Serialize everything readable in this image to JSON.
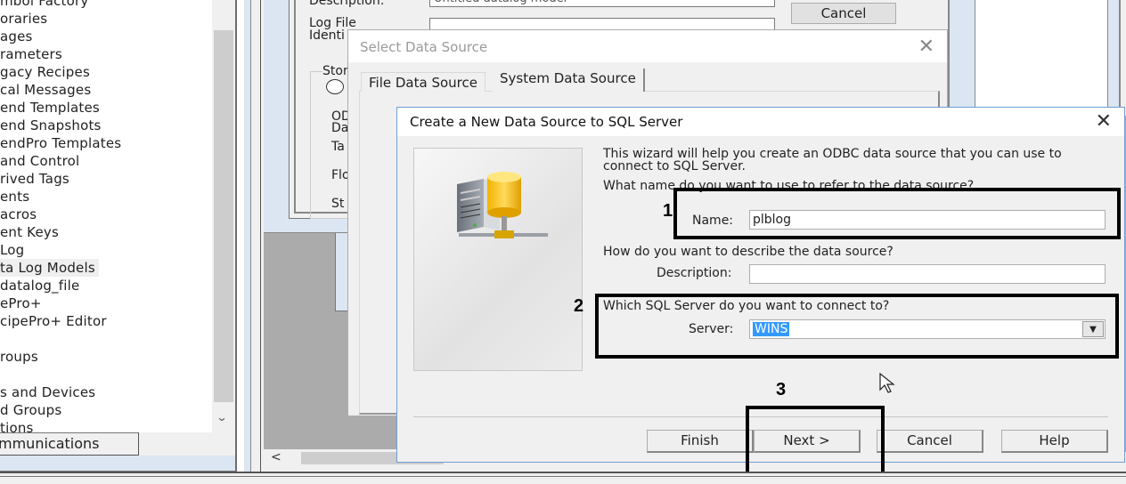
{
  "left_panel": {
    "tree_items": [
      {
        "label": "mbol Factory"
      },
      {
        "label": "oraries"
      },
      {
        "label": "ages"
      },
      {
        "label": "rameters"
      },
      {
        "label": "gacy Recipes"
      },
      {
        "label": "cal Messages"
      },
      {
        "label": "end Templates"
      },
      {
        "label": "end Snapshots"
      },
      {
        "label": "endPro Templates"
      },
      {
        "label": " and Control"
      },
      {
        "label": "rived Tags"
      },
      {
        "label": "ents"
      },
      {
        "label": "acros"
      },
      {
        "label": "ent Keys"
      },
      {
        "label": "Log"
      },
      {
        "label": "ta Log Models",
        "selected": true
      },
      {
        "label": "datalog_file"
      },
      {
        "label": "ePro+"
      },
      {
        "label": "cipePro+ Editor"
      },
      {
        "label": ""
      },
      {
        "label": "roups"
      },
      {
        "label": ""
      },
      {
        "label": "s and Devices"
      },
      {
        "label": "d Groups"
      },
      {
        "label": "tions"
      }
    ],
    "bottom_tab": "mmunications"
  },
  "background_window": {
    "description_label": "Description:",
    "description_value": "Untitled datalog model",
    "log_file_label_line1": "Log File",
    "log_file_label_line2": "Identi",
    "cancel_button": "Cancel",
    "storage_label": "Stor",
    "odbc_label_line1": "OD",
    "odbc_label_line2": "Da",
    "table_label": "Ta",
    "flow_label": "Flo",
    "string_label": "St"
  },
  "select_data_source": {
    "title": "Select Data Source",
    "tabs": [
      {
        "label": "File Data Source",
        "active": false
      },
      {
        "label": "System Data Source",
        "active": true
      }
    ]
  },
  "create_dsn": {
    "title": "Create a New Data Source to SQL Server",
    "intro_line1": "This wizard will help you create an ODBC data source that you can use to",
    "intro_line2": "connect to SQL Server.",
    "name_question": "What name do you want to use to refer to the data source?",
    "name_label": "Name:",
    "name_value": "plblog",
    "desc_question": "How do you want to describe the data source?",
    "desc_label": "Description:",
    "desc_value": "",
    "server_question": "Which SQL Server do you want to connect to?",
    "server_label": "Server:",
    "server_value": "WINS",
    "buttons": {
      "finish": "Finish",
      "next": "Next >",
      "cancel": "Cancel",
      "help": "Help"
    }
  },
  "annotations": {
    "step1": "1",
    "step2": "2",
    "step3": "3"
  },
  "scroll": {
    "left_arrow": "<",
    "down_arrow": "⌄"
  }
}
